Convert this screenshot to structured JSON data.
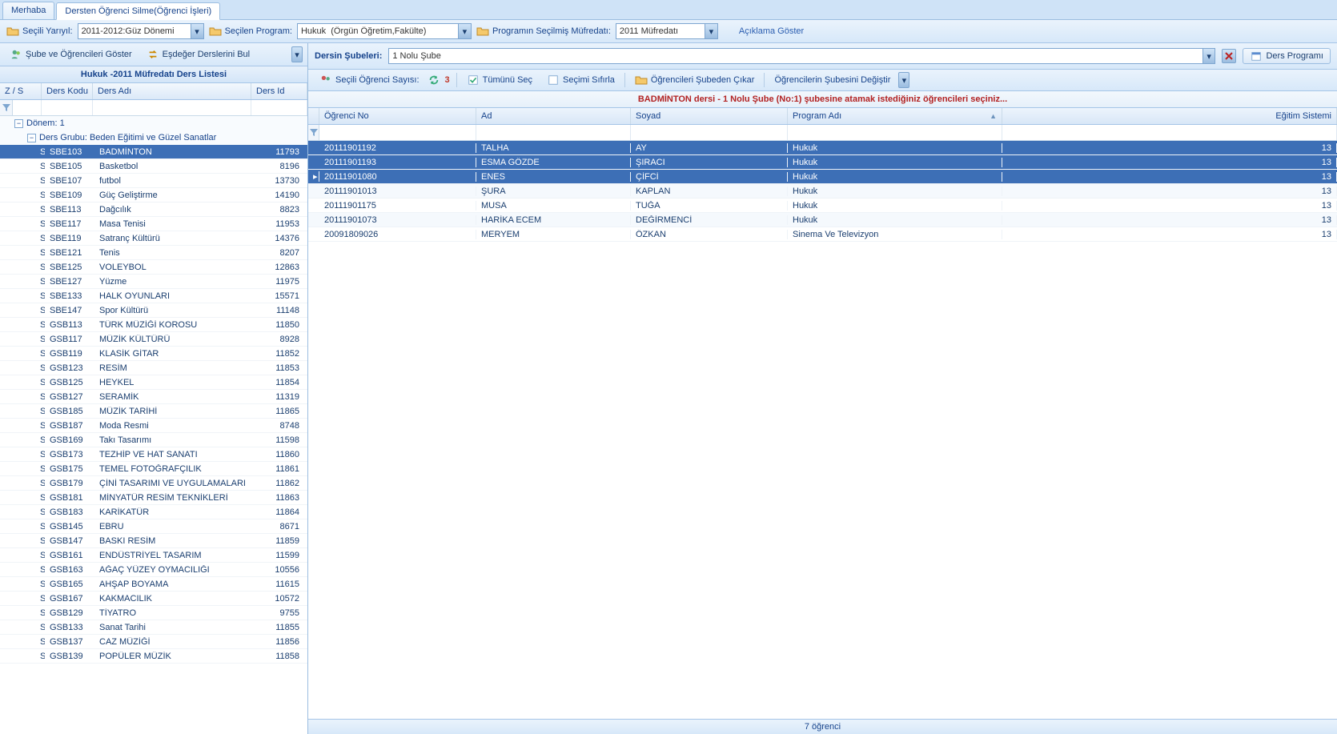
{
  "tabs": {
    "tab1": "Merhaba",
    "tab2": "Dersten Öğrenci Silme(Öğrenci İşleri)"
  },
  "topbar": {
    "semester_label": "Seçili Yarıyıl:",
    "semester_value": "2011-2012:Güz Dönemi",
    "program_label": "Seçilen Program:",
    "program_value": "Hukuk  (Örgün Öğretim,Fakülte)",
    "curriculum_label": "Programın Seçilmiş Müfredatı:",
    "curriculum_value": "2011 Müfredatı",
    "desc_link": "Açıklama Göster"
  },
  "left_toolbar": {
    "show_students": "Şube ve Öğrencileri Göster",
    "find_equiv": "Eşdeğer Derslerini Bul"
  },
  "left_panel_title": "Hukuk -2011 Müfredatı Ders Listesi",
  "left_cols": {
    "zs": "Z / S",
    "kod": "Ders Kodu",
    "ad": "Ders Adı",
    "id": "Ders Id"
  },
  "group1": "Dönem: 1",
  "group2": "Ders Grubu: Beden Eğitimi ve Güzel Sanatlar",
  "courses": [
    {
      "zs": "S...",
      "kod": "SBE103",
      "ad": "BADMİNTON",
      "id": "11793",
      "sel": true
    },
    {
      "zs": "S...",
      "kod": "SBE105",
      "ad": "Basketbol",
      "id": "8196"
    },
    {
      "zs": "S...",
      "kod": "SBE107",
      "ad": "futbol",
      "id": "13730"
    },
    {
      "zs": "S...",
      "kod": "SBE109",
      "ad": "Güç Geliştirme",
      "id": "14190"
    },
    {
      "zs": "S...",
      "kod": "SBE113",
      "ad": "Dağcılık",
      "id": "8823"
    },
    {
      "zs": "S...",
      "kod": "SBE117",
      "ad": "Masa Tenisi",
      "id": "11953"
    },
    {
      "zs": "S...",
      "kod": "SBE119",
      "ad": "Satranç Kültürü",
      "id": "14376"
    },
    {
      "zs": "S...",
      "kod": "SBE121",
      "ad": "Tenis",
      "id": "8207"
    },
    {
      "zs": "S...",
      "kod": "SBE125",
      "ad": "VOLEYBOL",
      "id": "12863"
    },
    {
      "zs": "S...",
      "kod": "SBE127",
      "ad": "Yüzme",
      "id": "11975"
    },
    {
      "zs": "S...",
      "kod": "SBE133",
      "ad": "HALK OYUNLARI",
      "id": "15571"
    },
    {
      "zs": "S...",
      "kod": "SBE147",
      "ad": "Spor Kültürü",
      "id": "11148"
    },
    {
      "zs": "S...",
      "kod": "GSB113",
      "ad": "TÜRK MÜZİĞİ KOROSU",
      "id": "11850"
    },
    {
      "zs": "S...",
      "kod": "GSB117",
      "ad": "MÜZİK KÜLTÜRÜ",
      "id": "8928"
    },
    {
      "zs": "S...",
      "kod": "GSB119",
      "ad": "KLASİK GİTAR",
      "id": "11852"
    },
    {
      "zs": "S...",
      "kod": "GSB123",
      "ad": "RESİM",
      "id": "11853"
    },
    {
      "zs": "S...",
      "kod": "GSB125",
      "ad": "HEYKEL",
      "id": "11854"
    },
    {
      "zs": "S...",
      "kod": "GSB127",
      "ad": "SERAMİK",
      "id": "11319"
    },
    {
      "zs": "S...",
      "kod": "GSB185",
      "ad": "MÜZİK TARİHİ",
      "id": "11865"
    },
    {
      "zs": "S...",
      "kod": "GSB187",
      "ad": "Moda Resmi",
      "id": "8748"
    },
    {
      "zs": "S...",
      "kod": "GSB169",
      "ad": "Takı Tasarımı",
      "id": "11598"
    },
    {
      "zs": "S...",
      "kod": "GSB173",
      "ad": "TEZHİP VE HAT SANATI",
      "id": "11860"
    },
    {
      "zs": "S...",
      "kod": "GSB175",
      "ad": "TEMEL FOTOĞRAFÇILIK",
      "id": "11861"
    },
    {
      "zs": "S...",
      "kod": "GSB179",
      "ad": "ÇİNİ TASARIMI VE UYGULAMALARI",
      "id": "11862"
    },
    {
      "zs": "S...",
      "kod": "GSB181",
      "ad": "MİNYATÜR RESİM TEKNİKLERİ",
      "id": "11863"
    },
    {
      "zs": "S...",
      "kod": "GSB183",
      "ad": "KARİKATÜR",
      "id": "11864"
    },
    {
      "zs": "S...",
      "kod": "GSB145",
      "ad": "EBRU",
      "id": "8671"
    },
    {
      "zs": "S...",
      "kod": "GSB147",
      "ad": "BASKI RESİM",
      "id": "11859"
    },
    {
      "zs": "S...",
      "kod": "GSB161",
      "ad": "ENDÜSTRİYEL TASARIM",
      "id": "11599"
    },
    {
      "zs": "S...",
      "kod": "GSB163",
      "ad": "AĞAÇ YÜZEY OYMACILIĞI",
      "id": "10556"
    },
    {
      "zs": "S...",
      "kod": "GSB165",
      "ad": "AHŞAP BOYAMA",
      "id": "11615"
    },
    {
      "zs": "S...",
      "kod": "GSB167",
      "ad": "KAKMACILIK",
      "id": "10572"
    },
    {
      "zs": "S...",
      "kod": "GSB129",
      "ad": "TİYATRO",
      "id": "9755"
    },
    {
      "zs": "S...",
      "kod": "GSB133",
      "ad": "Sanat Tarihi",
      "id": "11855"
    },
    {
      "zs": "S...",
      "kod": "GSB137",
      "ad": "CAZ MÜZİĞİ",
      "id": "11856"
    },
    {
      "zs": "S...",
      "kod": "GSB139",
      "ad": "POPÜLER MÜZİK",
      "id": "11858"
    }
  ],
  "right_header": {
    "sections_label": "Dersin Şubeleri:",
    "section_value": "1 Nolu Şube",
    "schedule_btn": "Ders Programı"
  },
  "right_tools": {
    "selected_label": "Seçili Öğrenci Sayısı:",
    "selected_count": "3",
    "select_all": "Tümünü Seç",
    "clear_sel": "Seçimi Sıfırla",
    "remove": "Öğrencileri Şubeden Çıkar",
    "move": "Öğrencilerin Şubesini Değiştir"
  },
  "instruction": "BADMİNTON dersi -  1 Nolu Şube (No:1) şubesine atamak istediğiniz öğrencileri seçiniz...",
  "student_cols": {
    "no": "Öğrenci No",
    "ad": "Ad",
    "soyad": "Soyad",
    "prog": "Program Adı",
    "egitim": "Eğitim Sistemi"
  },
  "students": [
    {
      "no": "20111901192",
      "ad": "TALHA",
      "soyad": "AY",
      "prog": "Hukuk",
      "eg": "13",
      "sel": true
    },
    {
      "no": "20111901193",
      "ad": "ESMA GÖZDE",
      "soyad": "ŞIRACI",
      "prog": "Hukuk",
      "eg": "13",
      "sel": true
    },
    {
      "no": "20111901080",
      "ad": "ENES",
      "soyad": "ÇİFCİ",
      "prog": "Hukuk",
      "eg": "13",
      "sel": true,
      "focus": true
    },
    {
      "no": "20111901013",
      "ad": "ŞURA",
      "soyad": "KAPLAN",
      "prog": "Hukuk",
      "eg": "13"
    },
    {
      "no": "20111901175",
      "ad": "MUSA",
      "soyad": "TUĞA",
      "prog": "Hukuk",
      "eg": "13"
    },
    {
      "no": "20111901073",
      "ad": "HARİKA ECEM",
      "soyad": "DEĞİRMENCİ",
      "prog": "Hukuk",
      "eg": "13"
    },
    {
      "no": "20091809026",
      "ad": "MERYEM",
      "soyad": "ÖZKAN",
      "prog": "Sinema Ve Televizyon",
      "eg": "13"
    }
  ],
  "footer": "7 öğrenci"
}
